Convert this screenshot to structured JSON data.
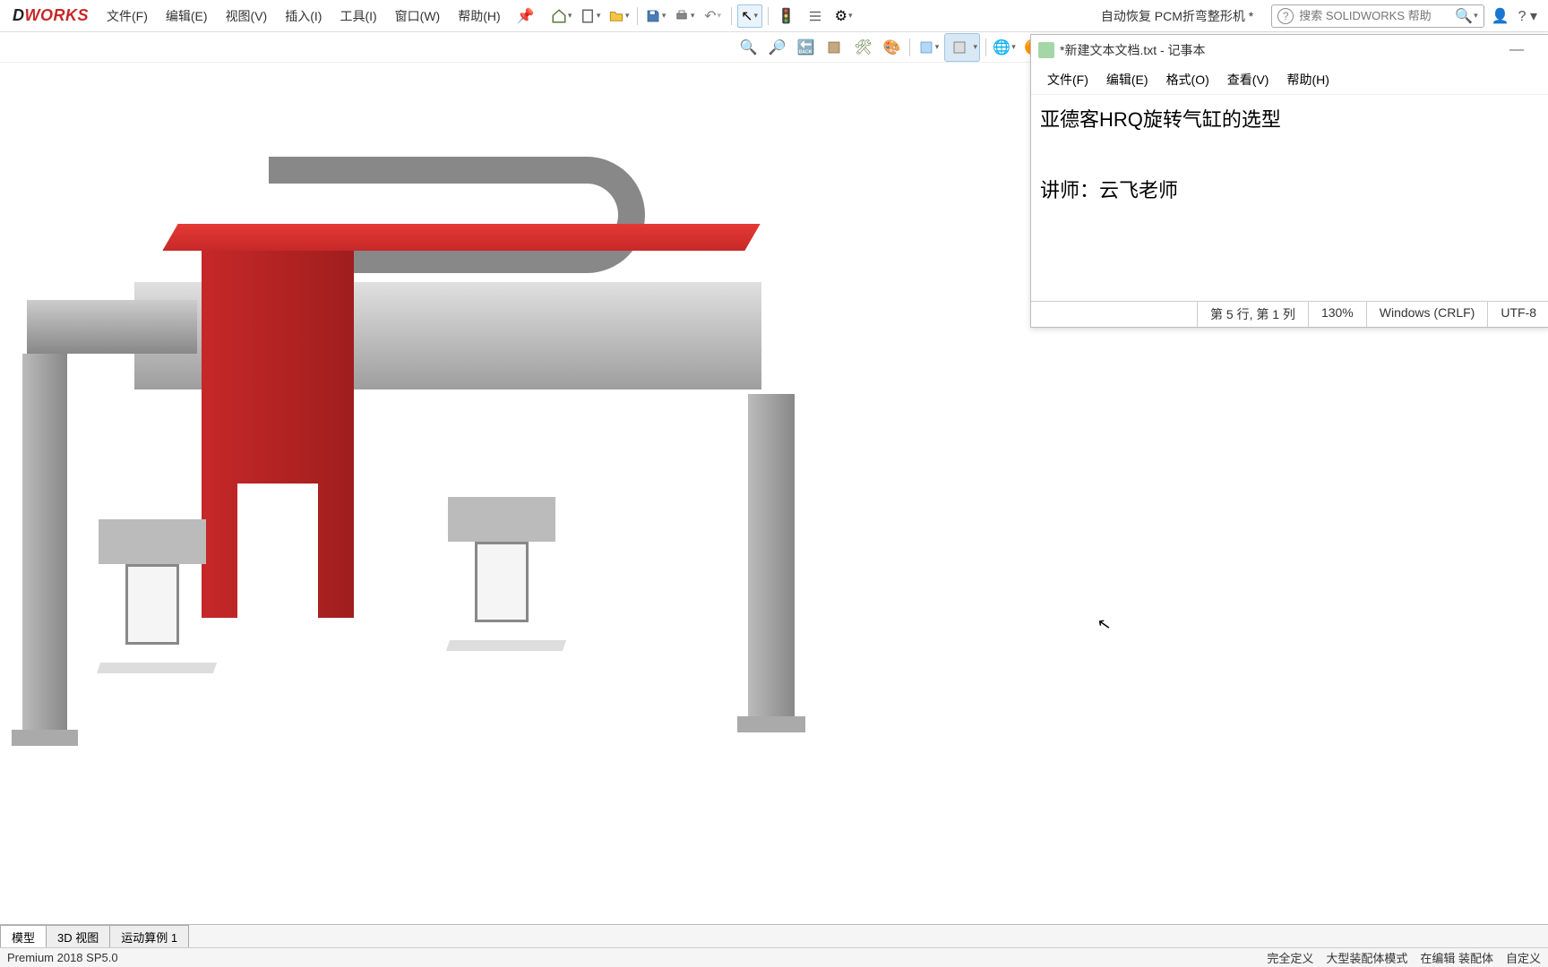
{
  "app": {
    "logo_pre": "D",
    "logo_post": "WORKS",
    "document_title": "自动恢复 PCM折弯整形机 *"
  },
  "menu": {
    "file": "文件(F)",
    "edit": "编辑(E)",
    "view": "视图(V)",
    "insert": "插入(I)",
    "tools": "工具(I)",
    "window": "窗口(W)",
    "help": "帮助(H)"
  },
  "search": {
    "placeholder": "搜索 SOLIDWORKS 帮助"
  },
  "notepad": {
    "title": "*新建文本文档.txt - 记事本",
    "menu": {
      "file": "文件(F)",
      "edit": "编辑(E)",
      "format": "格式(O)",
      "view": "查看(V)",
      "help": "帮助(H)"
    },
    "line1": "亚德客HRQ旋转气缸的选型",
    "line2": "讲师：云飞老师",
    "status": {
      "pos": "第 5 行, 第 1 列",
      "zoom": "130%",
      "eol": "Windows (CRLF)",
      "enc": "UTF-8"
    }
  },
  "tabs": {
    "model": "模型",
    "view3d": "3D 视图",
    "motion": "运动算例 1"
  },
  "statusbar": {
    "version": "Premium 2018 SP5.0",
    "s1": "完全定义",
    "s2": "大型装配体模式",
    "s3": "在编辑 装配体",
    "s4": "自定义"
  }
}
